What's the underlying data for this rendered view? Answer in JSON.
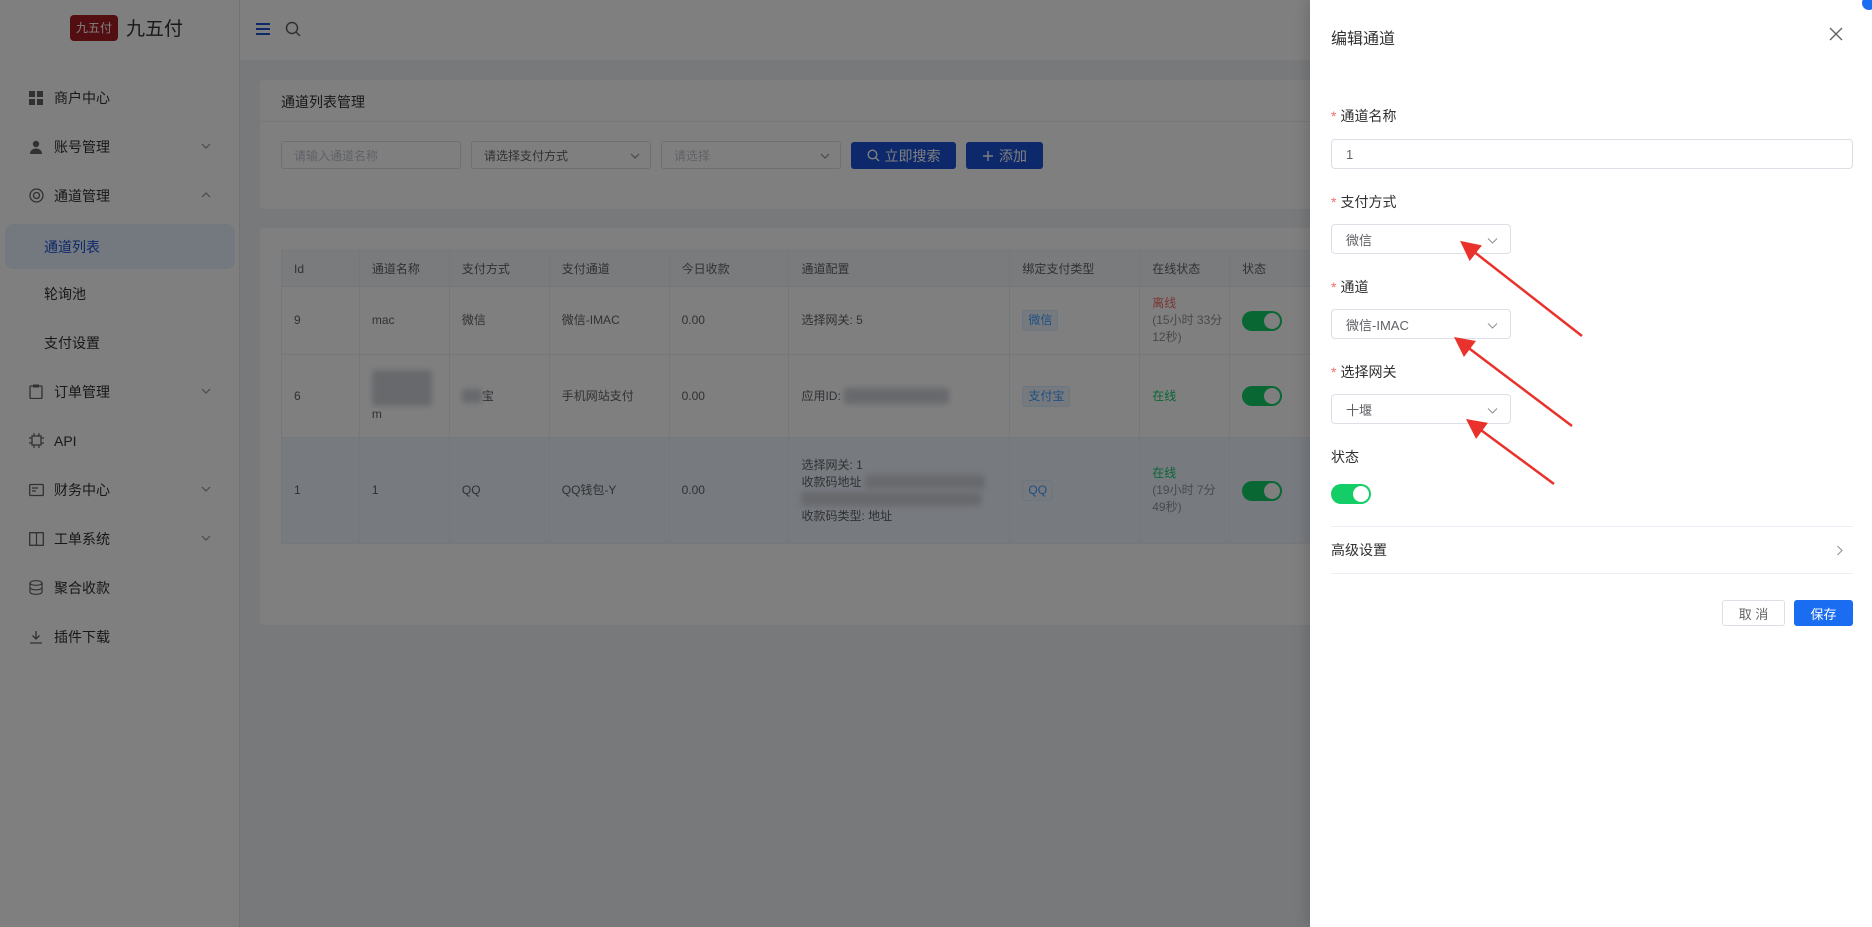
{
  "app": {
    "logo_mark": "九五付",
    "name": "九五付"
  },
  "sidebar": {
    "items": [
      {
        "label": "商户中心",
        "icon": "grid-icon"
      },
      {
        "label": "账号管理",
        "icon": "user-icon"
      },
      {
        "label": "通道管理",
        "icon": "lifebuoy-icon"
      },
      {
        "label": "通道列表"
      },
      {
        "label": "轮询池"
      },
      {
        "label": "支付设置"
      },
      {
        "label": "订单管理",
        "icon": "clipboard-icon"
      },
      {
        "label": "API",
        "icon": "chip-icon"
      },
      {
        "label": "财务中心",
        "icon": "wallet-icon"
      },
      {
        "label": "工单系统",
        "icon": "book-icon"
      },
      {
        "label": "聚合收款",
        "icon": "database-icon"
      },
      {
        "label": "插件下载",
        "icon": "download-icon"
      }
    ]
  },
  "filter": {
    "card_title": "通道列表管理",
    "name_placeholder": "请输入通道名称",
    "pay_method_placeholder": "请选择支付方式",
    "select_placeholder": "请选择",
    "search_label": "立即搜索",
    "add_label": "添加"
  },
  "table": {
    "headers": [
      "Id",
      "通道名称",
      "支付方式",
      "支付通道",
      "今日收款",
      "通道配置",
      "绑定支付类型",
      "在线状态",
      "状态"
    ],
    "rows": [
      {
        "id": "9",
        "name": "mac",
        "method": "微信",
        "channel": "微信-IMAC",
        "today": "0.00",
        "config": [
          "选择网关: 5"
        ],
        "bind_type": "微信",
        "online": "离线",
        "online_sub": "(15小时 33分 12秒)"
      },
      {
        "id": "6",
        "name": "m",
        "method": "宝",
        "channel": "手机网站支付",
        "today": "0.00",
        "config": [
          "应用ID:"
        ],
        "bind_type": "支付宝",
        "online": "在线",
        "online_sub": ""
      },
      {
        "id": "1",
        "name": "1",
        "method": "QQ",
        "channel": "QQ钱包-Y",
        "today": "0.00",
        "config": [
          "选择网关: 1",
          "收款码地址",
          "收款码类型: 地址"
        ],
        "bind_type": "QQ",
        "online": "在线",
        "online_sub": "(19小时 7分 49秒)"
      }
    ]
  },
  "drawer": {
    "title": "编辑通道",
    "name_label": "通道名称",
    "name_value": "1",
    "pay_method_label": "支付方式",
    "pay_method_value": "微信",
    "channel_label": "通道",
    "channel_value": "微信-IMAC",
    "gateway_label": "选择网关",
    "gateway_value": "十堰",
    "status_label": "状态",
    "advanced_label": "高级设置",
    "cancel_label": "取 消",
    "save_label": "保存"
  },
  "colors": {
    "primary": "#1a53d6",
    "switch_on": "#13ce66",
    "annotation": "#e8322b"
  }
}
